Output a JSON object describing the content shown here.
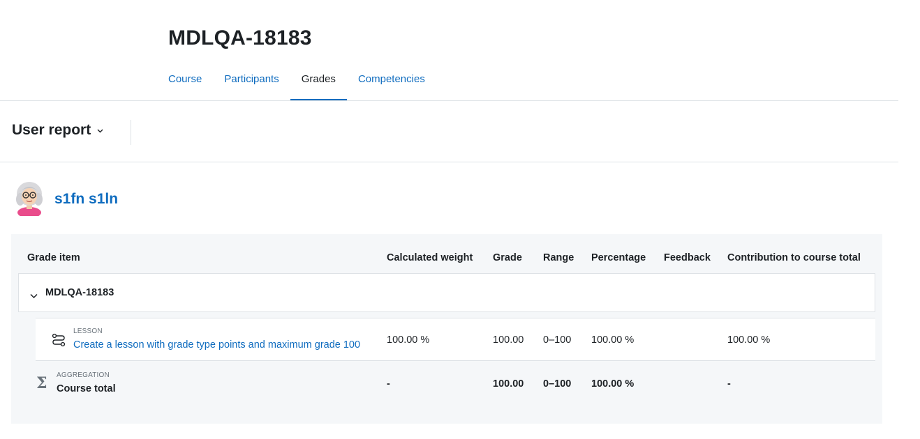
{
  "course": {
    "title": "MDLQA-18183"
  },
  "nav": {
    "tabs": [
      {
        "label": "Course",
        "active": false
      },
      {
        "label": "Participants",
        "active": false
      },
      {
        "label": "Grades",
        "active": true
      },
      {
        "label": "Competencies",
        "active": false
      }
    ]
  },
  "report": {
    "selector_label": "User report",
    "selector_icon": "chevron-down-icon"
  },
  "user": {
    "name": "s1fn s1ln",
    "avatar_icon": "user-avatar"
  },
  "table": {
    "headers": {
      "grade_item": "Grade item",
      "weight": "Calculated weight",
      "grade": "Grade",
      "range": "Range",
      "percentage": "Percentage",
      "feedback": "Feedback",
      "contribution": "Contribution to course total"
    },
    "category": {
      "name": "MDLQA-18183",
      "icon": "chevron-down-icon"
    },
    "item": {
      "type": "LESSON",
      "name": "Create a lesson with grade type points and maximum grade 100",
      "icon": "lesson-icon",
      "weight": "100.00 %",
      "grade": "100.00",
      "range": "0–100",
      "percentage": "100.00 %",
      "feedback": "",
      "contribution": "100.00 %"
    },
    "total": {
      "type": "AGGREGATION",
      "name": "Course total",
      "icon": "sigma-icon",
      "icon_glyph": "Σ",
      "weight": "-",
      "grade": "100.00",
      "range": "0–100",
      "percentage": "100.00 %",
      "feedback": "",
      "contribution": "-"
    }
  },
  "colors": {
    "link": "#0f6cbf",
    "text": "#1d2125",
    "muted": "#6a737b",
    "panel": "#f5f7f9",
    "border": "#dee2e6"
  }
}
